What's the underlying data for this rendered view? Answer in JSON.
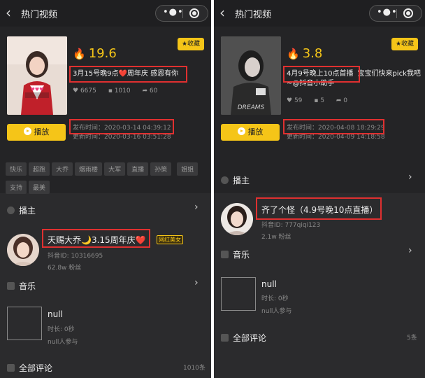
{
  "left": {
    "nav_title": "热门视频",
    "capsule_more": "•◉•",
    "score": "19.6",
    "video_title": "3月15号晚9点❤️周年庆 感恩有你",
    "likes": "6675",
    "comments": "1010",
    "shares": "60",
    "favorite_label": "收藏",
    "play_label": "播放",
    "publish_time": "发布时间：2020-03-14 04:39:12",
    "update_time": "更新时间：2020-03-16 03:51:28",
    "tags": [
      "快乐",
      "超跑",
      "大乔",
      "烟雨楼",
      "大军",
      "直播",
      "孙策",
      "姐姐",
      "支持",
      "最美"
    ],
    "anchor_section": "播主",
    "anchor_name": "天赐大乔🌙3.15周年庆❤️",
    "anchor_badge": "网红美女",
    "anchor_id": "抖音ID: 10316695",
    "anchor_fans": "62.8w 粉丝",
    "music_section": "音乐",
    "music_name": "null",
    "music_duration": "时长: 0秒",
    "music_users": "null人参与",
    "comments_section": "全部评论",
    "comments_count": "1010条"
  },
  "right": {
    "nav_title": "热门视频",
    "capsule_more": "•◉•",
    "score": "3.8",
    "video_title_part1": "4月9号晚上10点首播",
    "video_title_part2": "宝宝们快来pick我吧~@抖音小助手",
    "likes": "59",
    "comments": "5",
    "shares": "0",
    "favorite_label": "收藏",
    "play_label": "播放",
    "thumb_text": "DREAMS",
    "publish_time": "发布时间：2020-04-08 18:29:29",
    "update_time": "更新时间：2020-04-09 14:18:58",
    "anchor_section": "播主",
    "anchor_name": "齐了个怪（4.9号晚10点直播）",
    "anchor_id": "抖音ID: 777qiqi123",
    "anchor_fans": "2.1w 粉丝",
    "music_section": "音乐",
    "music_name": "null",
    "music_duration": "时长: 0秒",
    "music_users": "null人参与",
    "comments_section": "全部评论",
    "comments_count": "5条"
  }
}
